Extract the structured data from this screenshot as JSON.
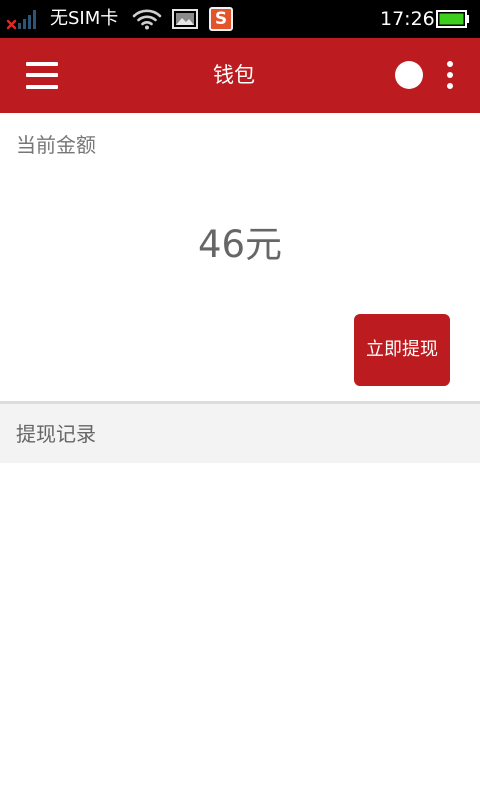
{
  "colors": {
    "status_bar_bg": "#000000",
    "app_bar_bg": "#BC1B20",
    "accent": "#BC1B20",
    "battery_green": "#3ecf1e",
    "text_gray": "#666666"
  },
  "status_bar": {
    "carrier": "无SIM卡",
    "time": "17:26",
    "ime_letter": "S",
    "icons": [
      "signal-no-sim-icon",
      "wifi-icon",
      "image-notification-icon",
      "sogou-input-icon",
      "battery-icon"
    ],
    "battery_level": 1.0
  },
  "app_bar": {
    "title": "钱包",
    "icons": [
      "menu-icon",
      "status-dot-icon",
      "overflow-menu-icon"
    ]
  },
  "balance": {
    "label": "当前金额",
    "amount": "46元",
    "withdraw_button": "立即提现"
  },
  "records": {
    "header": "提现记录",
    "items": []
  }
}
